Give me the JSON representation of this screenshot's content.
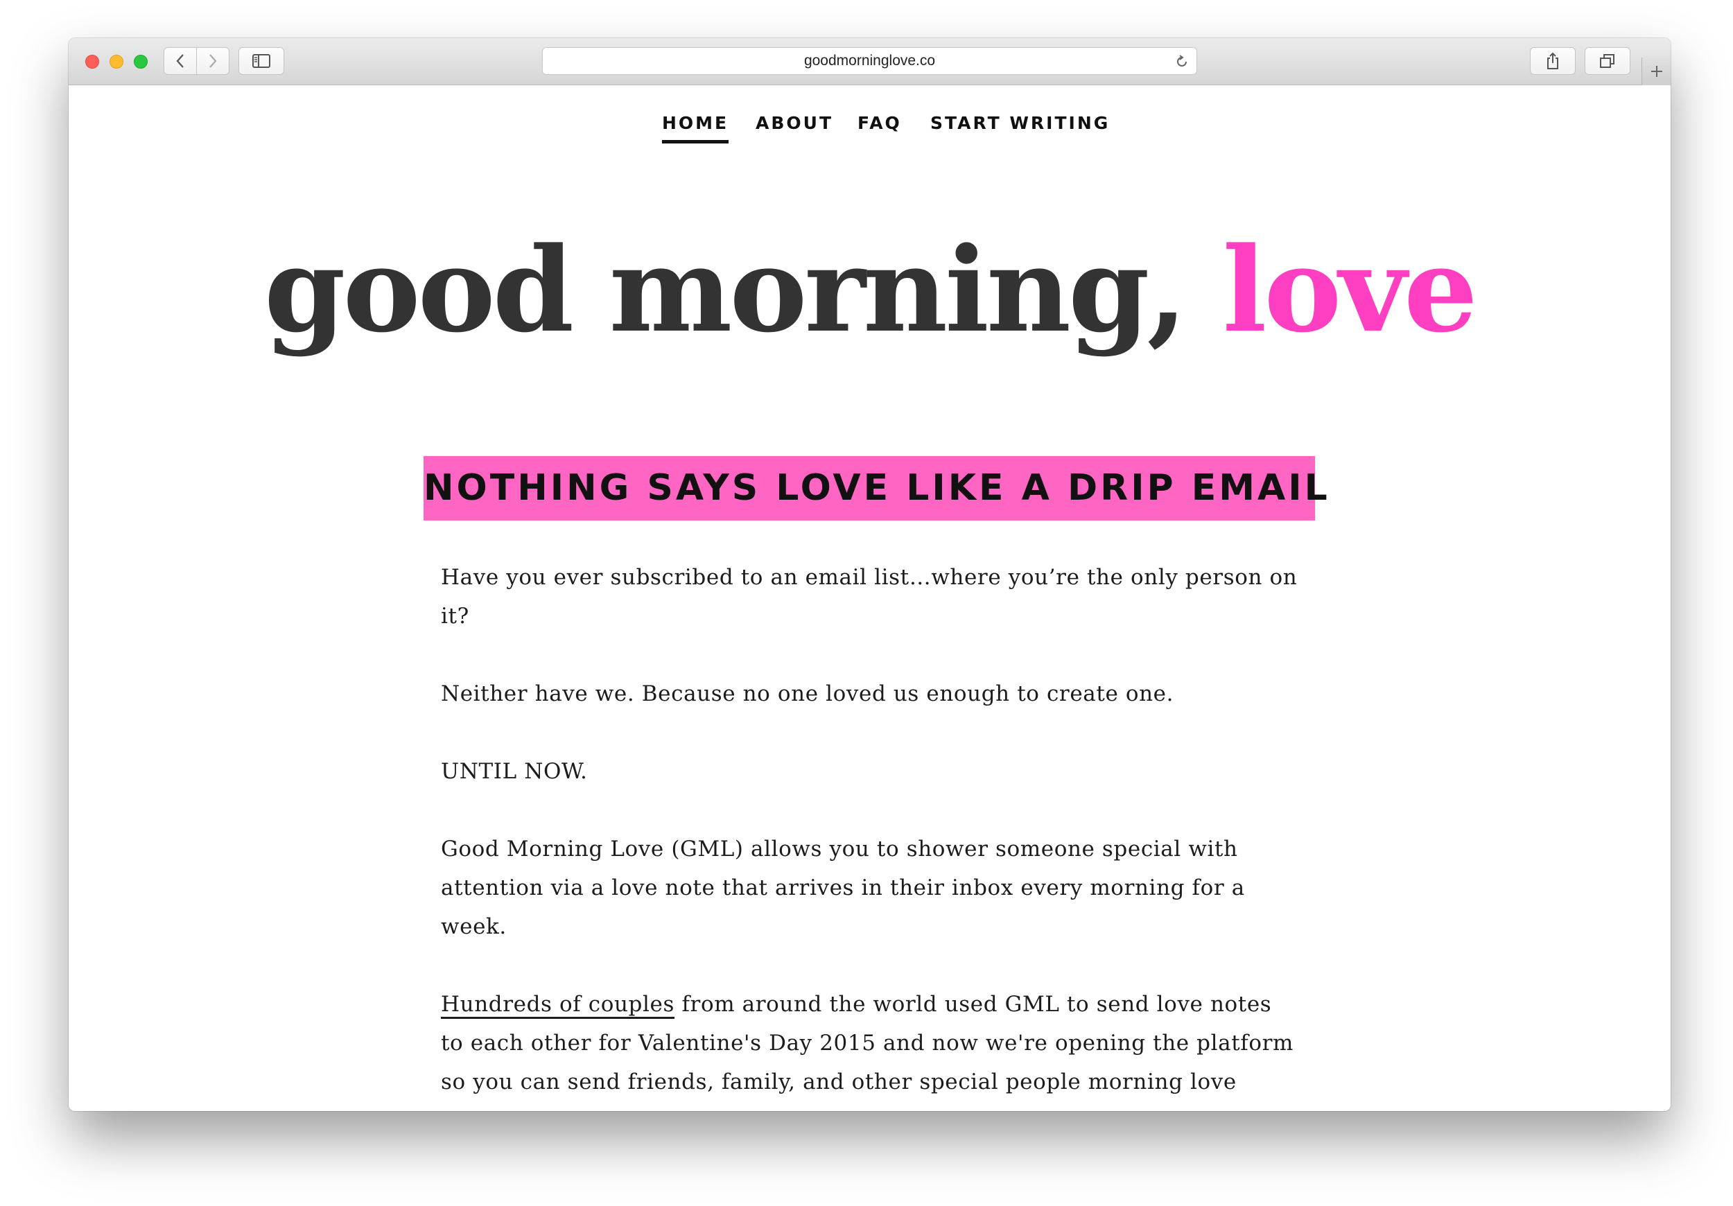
{
  "browser": {
    "url": "goodmorninglove.co"
  },
  "nav": {
    "home": "HOME",
    "about": "ABOUT",
    "faq": "FAQ",
    "start_writing": "START WRITING"
  },
  "logo": {
    "dark_text": "good morning,",
    "pink_text": "love",
    "pink_color": "#ff3fc1"
  },
  "tagline": {
    "text": "NOTHING SAYS LOVE LIKE A DRIP EMAIL",
    "background": "#ff66c4"
  },
  "article": {
    "p1": "Have you ever subscribed to an email list…where you’re the only person on it?",
    "p2": "Neither have we. Because no one loved us enough to create one.",
    "p3": "UNTIL NOW.",
    "p4": "Good Morning Love (GML) allows you to shower someone special with attention via a love note that arrives in their inbox every morning for a week.",
    "p5_link": "Hundreds of couples",
    "p5_rest": "from around the world used GML to send love notes to each other for Valentine's Day 2015 and now we're opening the platform so you can send friends, family, and other special people morning love notes"
  }
}
